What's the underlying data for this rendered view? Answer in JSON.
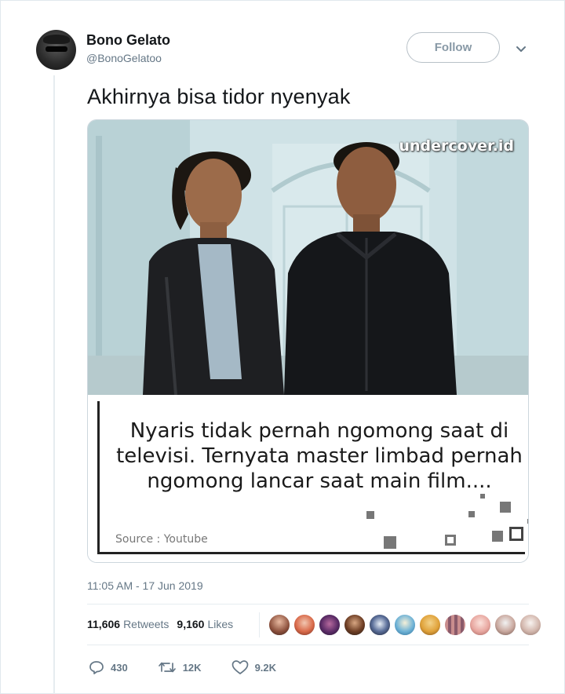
{
  "user": {
    "name": "Bono Gelato",
    "handle": "@BonoGelatoo"
  },
  "follow_label": "Follow",
  "tweet": {
    "text": "Akhirnya bisa tidor nyenyak",
    "timestamp": "11:05 AM - 17 Jun 2019"
  },
  "media": {
    "watermark": "undercover.id",
    "caption": "Nyaris tidak pernah ngomong saat di televisi. Ternyata master limbad pernah ngomong lancar saat main film....",
    "source": "Source : Youtube"
  },
  "stats": {
    "retweets_count": "11,606",
    "retweets_label": "Retweets",
    "likes_count": "9,160",
    "likes_label": "Likes"
  },
  "actions": {
    "reply_count": "430",
    "retweet_count": "12K",
    "like_count": "9.2K"
  },
  "icons": [
    "caret-down-icon",
    "reply-icon",
    "retweet-icon",
    "heart-icon"
  ],
  "colors": {
    "text_primary": "#14171a",
    "text_secondary": "#657786",
    "border": "#e6ecf0"
  }
}
